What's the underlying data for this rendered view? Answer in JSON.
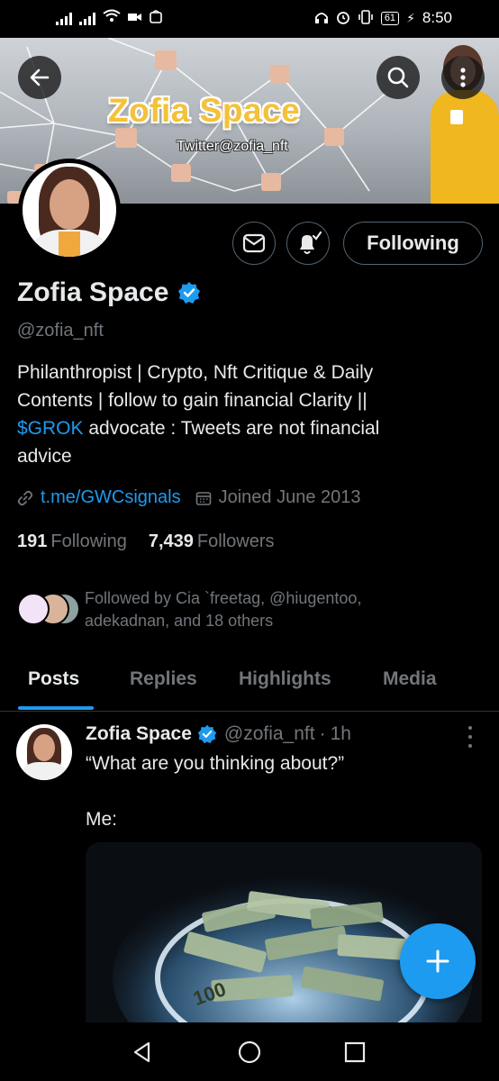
{
  "status_bar": {
    "time": "8:50",
    "battery": "61"
  },
  "banner": {
    "title": "Zofia Space",
    "subtitle": "Twitter@zofia_nft"
  },
  "profile": {
    "name": "Zofia Space",
    "handle": "@zofia_nft",
    "verified": true,
    "following_button": "Following",
    "bio_line1": "Philanthropist | Crypto, Nft Critique & Daily",
    "bio_line2": "Contents | follow to gain financial Clarity ||",
    "bio_cashtag": "$GROK",
    "bio_line3_rest": " advocate : Tweets are not financial",
    "bio_line4": "advice",
    "link": "t.me/GWCsignals",
    "joined": "Joined June 2013",
    "following_count": "191",
    "following_label": "Following",
    "followers_count": "7,439",
    "followers_label": "Followers",
    "followed_by_text": "Followed by Cia `freetag, @hiugentoo, adekadnan, and 18 others"
  },
  "tabs": [
    "Posts",
    "Replies",
    "Highlights",
    "Media"
  ],
  "active_tab": "Posts",
  "post": {
    "author_name": "Zofia Space",
    "author_handle": "@zofia_nft",
    "separator": "·",
    "time": "1h",
    "text_line1": "“What are you thinking about?”",
    "text_line2": "Me:",
    "media_caption": "100"
  },
  "colors": {
    "accent": "#1d9bf0",
    "background": "#000000",
    "text_primary": "#e7e9ea",
    "text_secondary": "#71767b",
    "banner_title": "#f3c23a"
  },
  "icons": {
    "back": "arrow-left-icon",
    "search": "search-icon",
    "more": "more-vertical-icon",
    "message": "envelope-icon",
    "notifications": "bell-check-icon",
    "verified": "verified-badge-icon",
    "link": "link-icon",
    "calendar": "calendar-icon",
    "compose": "plus-icon"
  }
}
